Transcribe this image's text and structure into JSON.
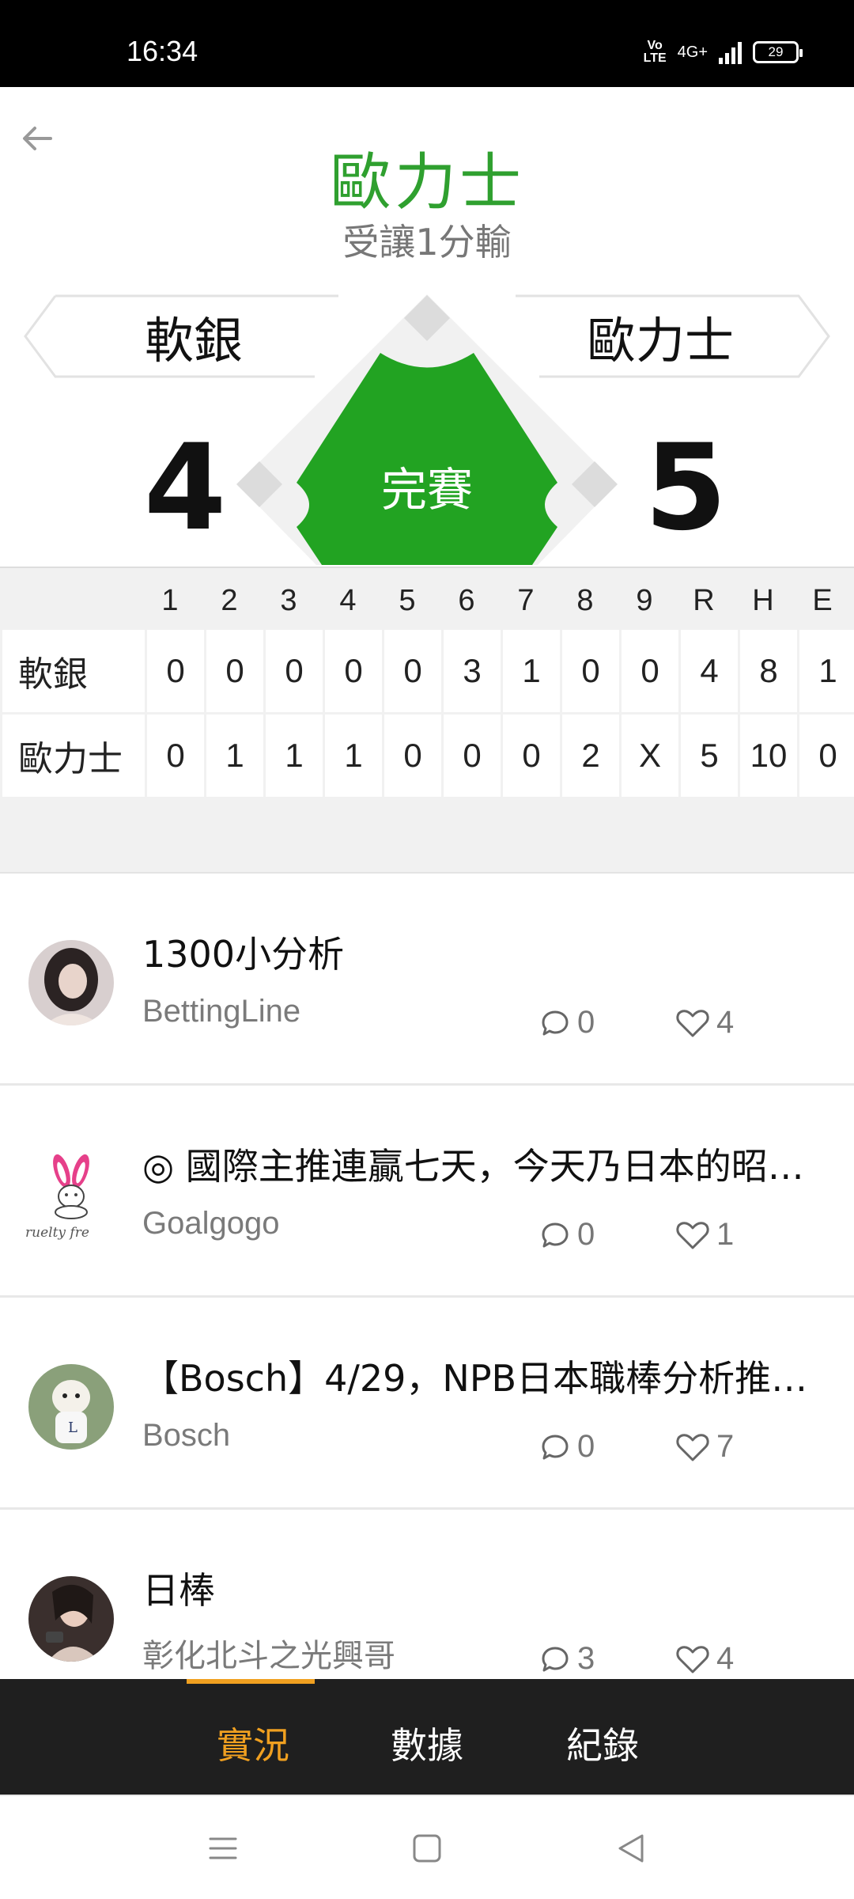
{
  "status_bar": {
    "time": "16:34",
    "network": "4G+",
    "volte": "Vo\nLTE",
    "battery": "29"
  },
  "header": {
    "winner": "歐力士",
    "handicap_result": "受讓1分輸"
  },
  "game": {
    "away_team": "軟銀",
    "home_team": "歐力士",
    "away_score": "4",
    "home_score": "5",
    "status": "完賽"
  },
  "linescore": {
    "columns": [
      "1",
      "2",
      "3",
      "4",
      "5",
      "6",
      "7",
      "8",
      "9",
      "R",
      "H",
      "E"
    ],
    "rows": [
      {
        "team": "軟銀",
        "cells": [
          "0",
          "0",
          "0",
          "0",
          "0",
          "3",
          "1",
          "0",
          "0",
          "4",
          "8",
          "1"
        ]
      },
      {
        "team": "歐力士",
        "cells": [
          "0",
          "1",
          "1",
          "1",
          "0",
          "0",
          "0",
          "2",
          "X",
          "5",
          "10",
          "0"
        ]
      }
    ]
  },
  "posts": [
    {
      "title": "1300小分析",
      "author": "BettingLine",
      "comments": "0",
      "likes": "4"
    },
    {
      "title": "◎ 國際主推連贏七天，今天乃日本的昭…",
      "author": "Goalgogo",
      "comments": "0",
      "likes": "1"
    },
    {
      "title": "【Bosch】4/29，NPB日本職棒分析推…",
      "author": "Bosch",
      "comments": "0",
      "likes": "7"
    },
    {
      "title": "日棒",
      "author": "彰化北斗之光興哥",
      "comments": "3",
      "likes": "4"
    }
  ],
  "avatar_2_text": "ruelty fre",
  "tabs": [
    {
      "label": "實況"
    },
    {
      "label": "數據"
    },
    {
      "label": "紀錄"
    }
  ],
  "colors": {
    "accent_green": "#2fa02f",
    "diamond_green": "#22a322",
    "tab_active": "#f0a020",
    "tabbar_bg": "#1f1f1f"
  }
}
